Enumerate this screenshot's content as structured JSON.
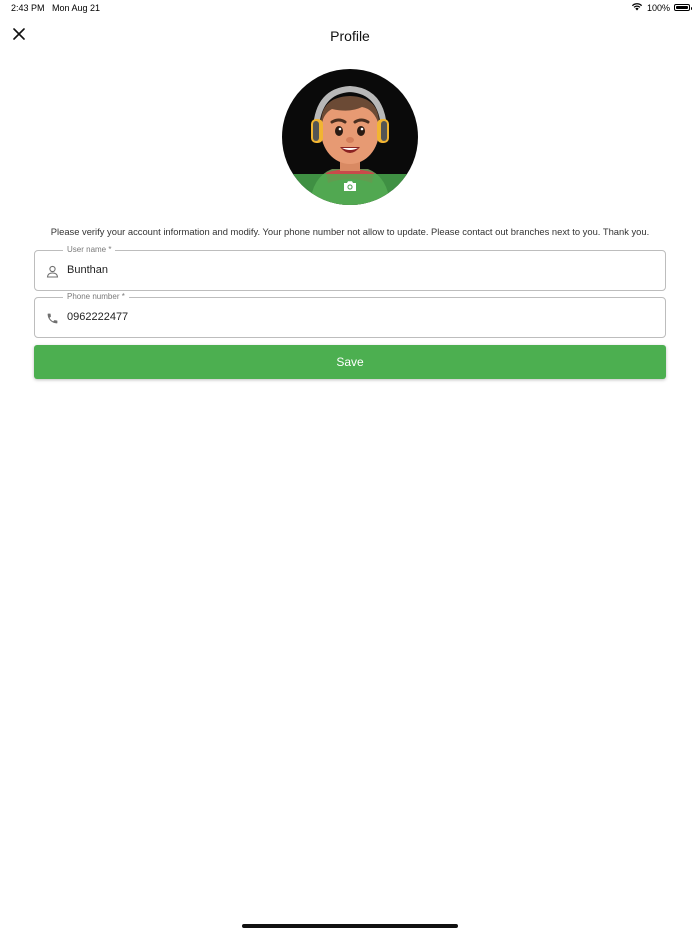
{
  "status_bar": {
    "time": "2:43 PM",
    "date": "Mon Aug 21",
    "battery": "100%",
    "icons": [
      "wifi-icon",
      "battery-icon"
    ]
  },
  "header": {
    "title": "Profile",
    "close_icon": "close-icon"
  },
  "avatar": {
    "camera_icon": "camera-icon",
    "overlay_color": "#4caf50"
  },
  "info_text": "Please verify your account information and modify. Your phone number not allow to update. Please contact out branches next to you. Thank you.",
  "form": {
    "username": {
      "label": "User name *",
      "value": "Bunthan",
      "icon": "person-icon"
    },
    "phone": {
      "label": "Phone number *",
      "value": "0962222477",
      "icon": "phone-icon"
    },
    "save_label": "Save"
  },
  "colors": {
    "accent": "#4caf50",
    "border": "#bdbdbd",
    "label": "#7a7a7a"
  }
}
